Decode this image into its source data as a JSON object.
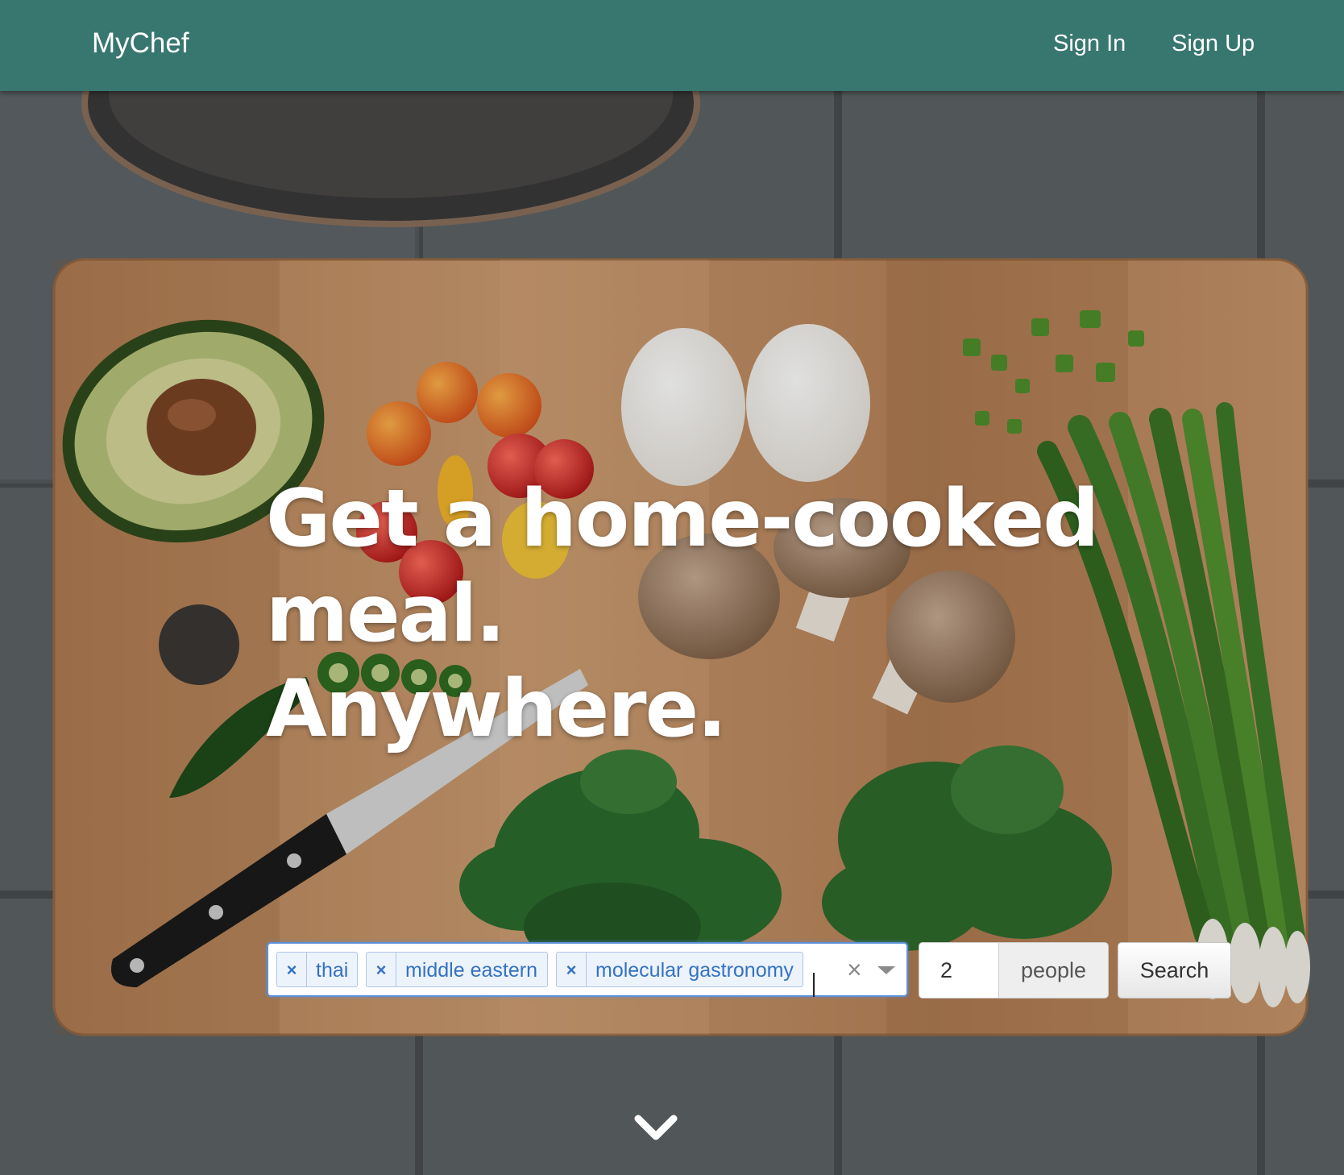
{
  "navbar": {
    "brand": "MyChef",
    "links": [
      "Sign In",
      "Sign Up"
    ],
    "background_color": "#387670"
  },
  "hero": {
    "headline_lines": [
      "Get a home-cooked",
      "meal.",
      "Anywhere."
    ],
    "background_image": "cutting board with avocado, tomatoes, eggs, mushrooms, jalapeño, knife, spinach, arugula, green onions"
  },
  "search": {
    "cuisine_tags": [
      "thai",
      "middle eastern",
      "molecular gastronomy"
    ],
    "tag_remove_symbol": "×",
    "clear_symbol": "×",
    "people_value": "2",
    "people_addon": "people",
    "button_label": "Search"
  },
  "icons": {
    "scroll_down": "chevron-down-icon"
  },
  "colors": {
    "accent": "#387670",
    "tag_text": "#3372c4",
    "tag_bg": "#edf3fb",
    "focus_border": "#5b8fd8"
  }
}
